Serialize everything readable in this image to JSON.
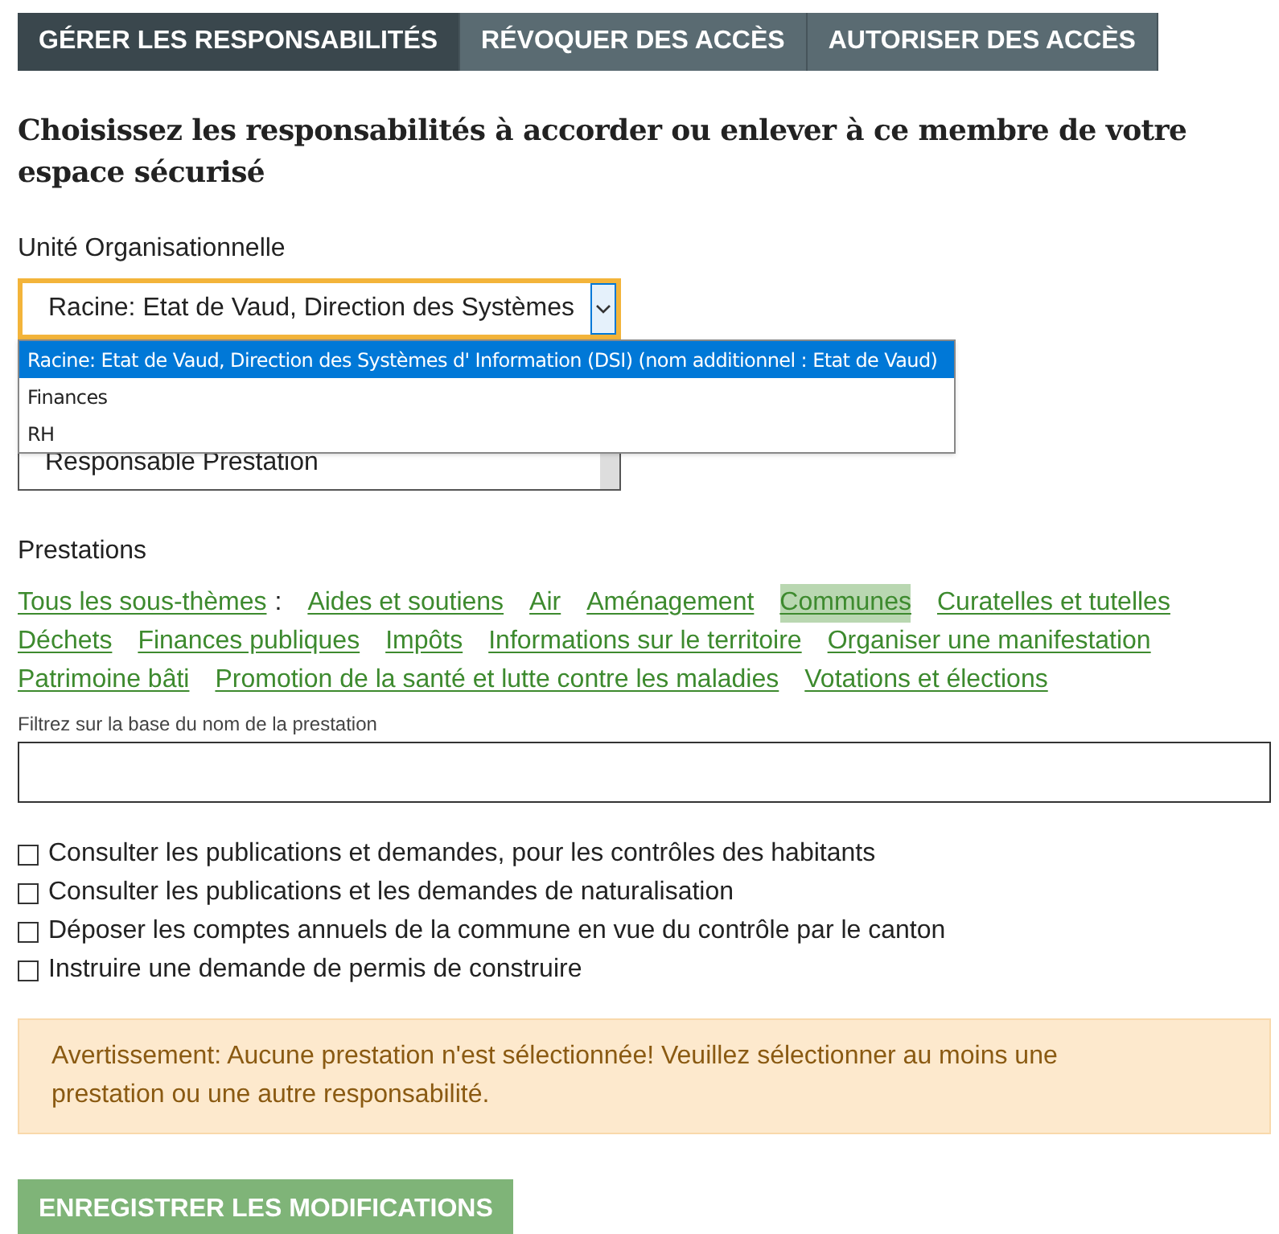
{
  "tabs": [
    {
      "label": "GÉRER LES RESPONSABILITÉS",
      "selected": true
    },
    {
      "label": "RÉVOQUER DES ACCÈS",
      "selected": false
    },
    {
      "label": "AUTORISER DES ACCÈS",
      "selected": false
    }
  ],
  "heading": "Choisissez les responsabilités à accorder ou enlever à ce membre de votre espace sécurisé",
  "unit_select": {
    "label": "Unité Organisationnelle",
    "value": "Racine: Etat de Vaud, Direction des Systèmes",
    "focused": true,
    "options": [
      {
        "label": "Racine: Etat de Vaud, Direction des Systèmes d' Information (DSI) (nom additionnel : Etat de Vaud)",
        "selected": true
      },
      {
        "label": "Finances",
        "selected": false
      },
      {
        "label": "RH",
        "selected": false
      }
    ]
  },
  "role_select": {
    "value": "Responsable Prestation"
  },
  "prestations": {
    "label": "Prestations",
    "all_link": {
      "label": "Tous les sous-thèmes",
      "selected": false
    },
    "separator": ":",
    "themes": [
      {
        "label": "Aides et soutiens",
        "selected": false
      },
      {
        "label": "Air",
        "selected": false
      },
      {
        "label": "Aménagement",
        "selected": false
      },
      {
        "label": "Communes",
        "selected": true
      },
      {
        "label": "Curatelles et tutelles",
        "selected": false
      },
      {
        "label": "Déchets",
        "selected": false
      },
      {
        "label": "Finances publiques",
        "selected": false
      },
      {
        "label": "Impôts",
        "selected": false
      },
      {
        "label": "Informations sur le territoire",
        "selected": false
      },
      {
        "label": "Organiser une manifestation",
        "selected": false
      },
      {
        "label": "Patrimoine bâti",
        "selected": false
      },
      {
        "label": "Promotion de la santé et lutte contre les maladies",
        "selected": false
      },
      {
        "label": "Votations et élections",
        "selected": false
      }
    ]
  },
  "filter": {
    "label": "Filtrez sur la base du nom de la prestation"
  },
  "services": [
    {
      "label": "Consulter les publications et demandes, pour les contrôles des habitants",
      "checked": false
    },
    {
      "label": "Consulter les publications et les demandes de naturalisation",
      "checked": false
    },
    {
      "label": "Déposer les comptes annuels de la commune en vue du contrôle par le canton",
      "checked": false
    },
    {
      "label": "Instruire une demande de permis de construire",
      "checked": false
    }
  ],
  "warning": "Avertissement: Aucune prestation n'est sélectionnée! Veuillez sélectionner au moins une prestation ou une autre responsabilité.",
  "save_button": "ENREGISTRER LES MODIFICATIONS"
}
